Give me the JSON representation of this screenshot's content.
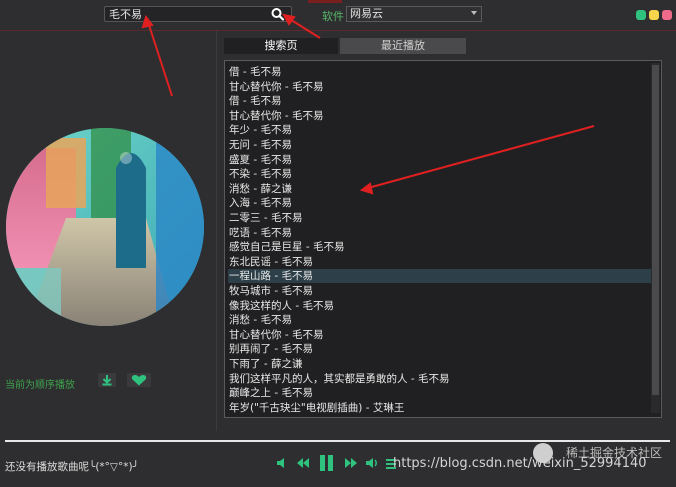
{
  "search": {
    "query": "毛不易"
  },
  "source": {
    "label": "软件",
    "selected": "网易云"
  },
  "window_buttons": {
    "colors": [
      "#2ec27e",
      "#f6d44c",
      "#ef6b8a"
    ]
  },
  "tabs": [
    {
      "label": "搜索页",
      "active": true
    },
    {
      "label": "最近播放",
      "active": false
    }
  ],
  "songs": [
    "借 - 毛不易",
    "甘心替代你 - 毛不易",
    "借 - 毛不易",
    "甘心替代你 - 毛不易",
    "年少 - 毛不易",
    "无问 - 毛不易",
    "盛夏 - 毛不易",
    "不染 - 毛不易",
    "消愁 - 薛之谦",
    "入海 - 毛不易",
    "二零三 - 毛不易",
    "呓语 - 毛不易",
    "感觉自己是巨星 - 毛不易",
    "东北民谣 - 毛不易",
    "一程山路 - 毛不易",
    "牧马城市 - 毛不易",
    "像我这样的人 - 毛不易",
    "消愁 - 毛不易",
    "甘心替代你 - 毛不易",
    "别再闹了 - 毛不易",
    "下雨了 - 薛之谦",
    "我们这样平凡的人，其实都是勇敢的人 - 毛不易",
    "巅峰之上 - 毛不易",
    "年岁(\"千古玦尘\"电视剧插曲) - 艾琳王"
  ],
  "selected_index": 14,
  "left_panel": {
    "play_mode": "当前为顺序播放"
  },
  "player": {
    "status": "还没有播放歌曲呢╰(*°▽°*)╯",
    "progress": 1.0
  },
  "watermark": {
    "url": "https://blog.csdn.net/weixin_52994140",
    "brand": "稀土掘金技术社区",
    "id": "52994140"
  },
  "accent_colors": {
    "green": "#3fa34d",
    "list_bg": "#202022",
    "selected_row": "#2d4049"
  }
}
